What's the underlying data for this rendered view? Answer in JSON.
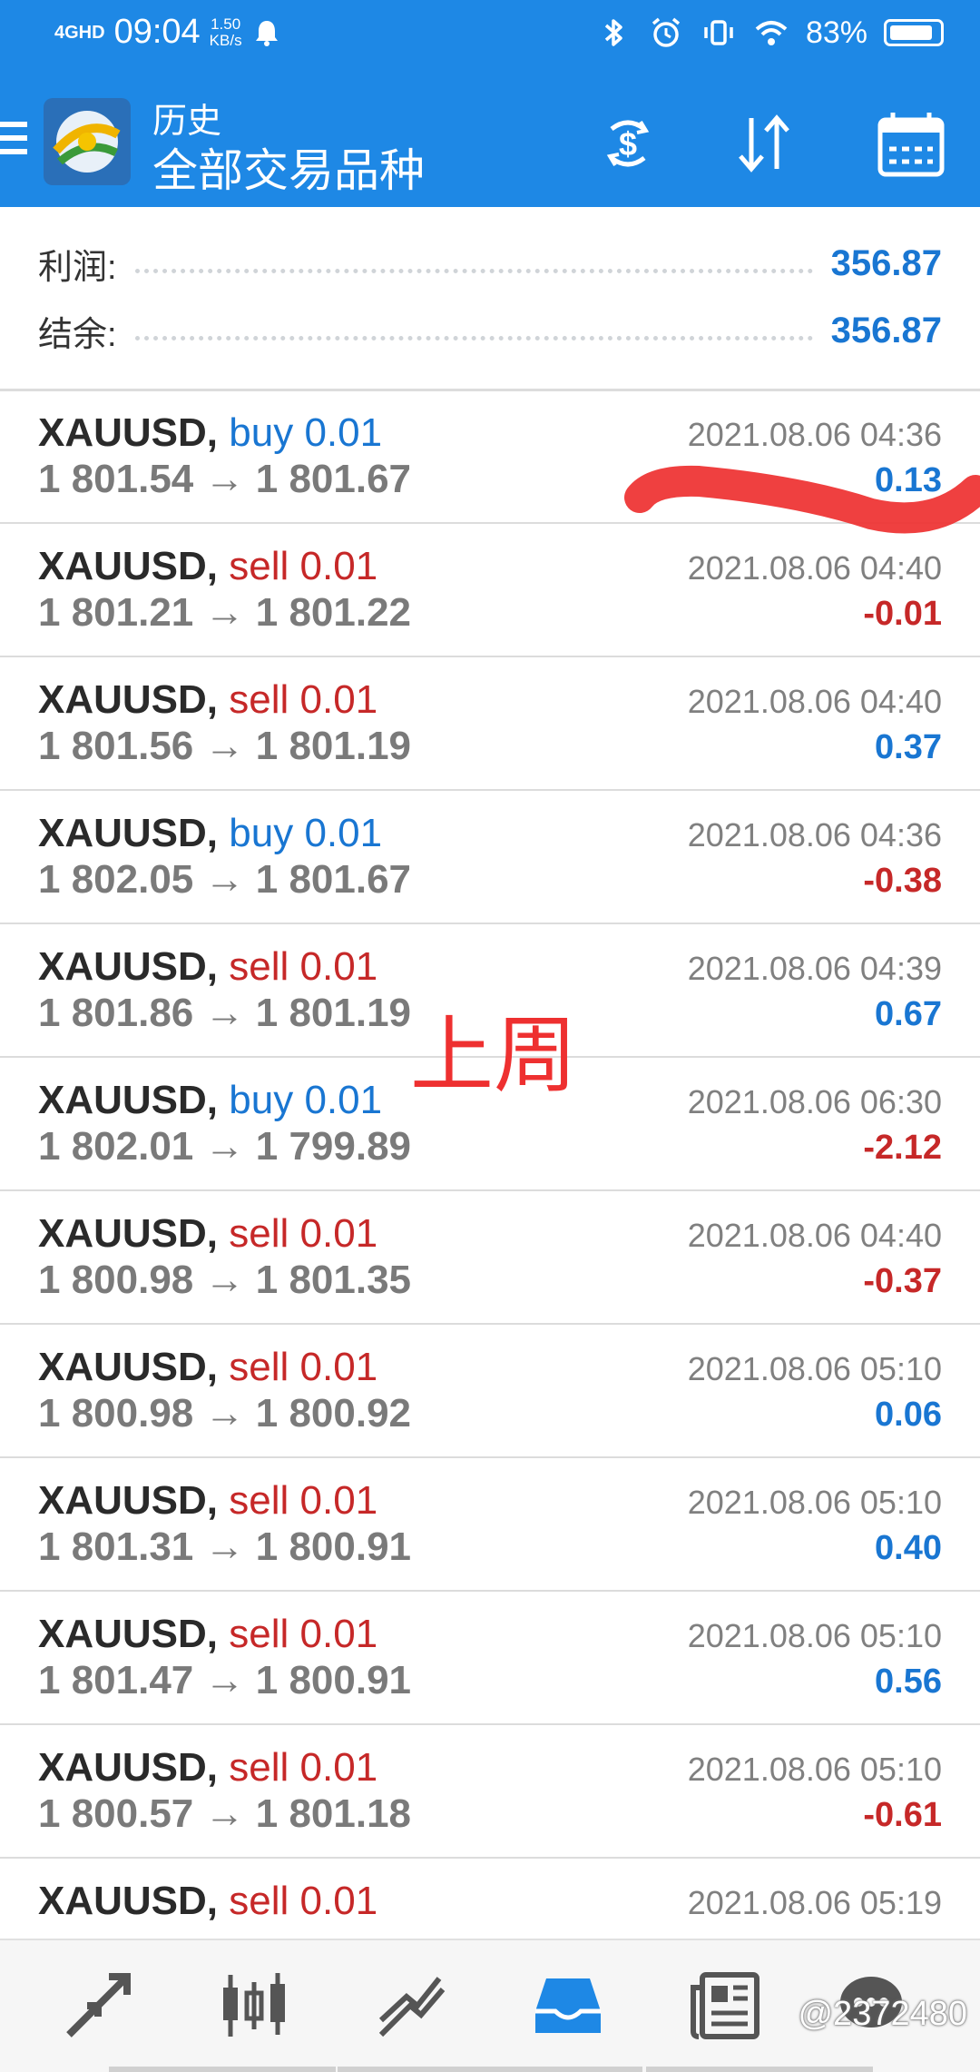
{
  "status_bar": {
    "network": "4GHD",
    "time": "09:04",
    "speed_value": "1.50",
    "speed_unit": "KB/s",
    "battery": "83%"
  },
  "app_bar": {
    "title": "历史",
    "subtitle": "全部交易品种",
    "icons": [
      "menu-icon",
      "app-logo-icon",
      "currency-exchange-icon",
      "sort-icon",
      "calendar-icon"
    ]
  },
  "summary": {
    "profit_label": "利润:",
    "profit_value": "356.87",
    "balance_label": "结余:",
    "balance_value": "356.87"
  },
  "trades": [
    {
      "symbol": "XAUUSD,",
      "side": "buy",
      "volume": "0.01",
      "open": "1 801.54",
      "close": "1 801.67",
      "date": "2021.08.06 04:36",
      "profit": "0.13"
    },
    {
      "symbol": "XAUUSD,",
      "side": "sell",
      "volume": "0.01",
      "open": "1 801.21",
      "close": "1 801.22",
      "date": "2021.08.06 04:40",
      "profit": "-0.01"
    },
    {
      "symbol": "XAUUSD,",
      "side": "sell",
      "volume": "0.01",
      "open": "1 801.56",
      "close": "1 801.19",
      "date": "2021.08.06 04:40",
      "profit": "0.37"
    },
    {
      "symbol": "XAUUSD,",
      "side": "buy",
      "volume": "0.01",
      "open": "1 802.05",
      "close": "1 801.67",
      "date": "2021.08.06 04:36",
      "profit": "-0.38"
    },
    {
      "symbol": "XAUUSD,",
      "side": "sell",
      "volume": "0.01",
      "open": "1 801.86",
      "close": "1 801.19",
      "date": "2021.08.06 04:39",
      "profit": "0.67"
    },
    {
      "symbol": "XAUUSD,",
      "side": "buy",
      "volume": "0.01",
      "open": "1 802.01",
      "close": "1 799.89",
      "date": "2021.08.06 06:30",
      "profit": "-2.12"
    },
    {
      "symbol": "XAUUSD,",
      "side": "sell",
      "volume": "0.01",
      "open": "1 800.98",
      "close": "1 801.35",
      "date": "2021.08.06 04:40",
      "profit": "-0.37"
    },
    {
      "symbol": "XAUUSD,",
      "side": "sell",
      "volume": "0.01",
      "open": "1 800.98",
      "close": "1 800.92",
      "date": "2021.08.06 05:10",
      "profit": "0.06"
    },
    {
      "symbol": "XAUUSD,",
      "side": "sell",
      "volume": "0.01",
      "open": "1 801.31",
      "close": "1 800.91",
      "date": "2021.08.06 05:10",
      "profit": "0.40"
    },
    {
      "symbol": "XAUUSD,",
      "side": "sell",
      "volume": "0.01",
      "open": "1 801.47",
      "close": "1 800.91",
      "date": "2021.08.06 05:10",
      "profit": "0.56"
    },
    {
      "symbol": "XAUUSD,",
      "side": "sell",
      "volume": "0.01",
      "open": "1 800.57",
      "close": "1 801.18",
      "date": "2021.08.06 05:10",
      "profit": "-0.61"
    },
    {
      "symbol": "XAUUSD,",
      "side": "sell",
      "volume": "0.01",
      "open": "",
      "close": "",
      "date": "2021.08.06 05:19",
      "profit": ""
    }
  ],
  "annotation": {
    "text": "上周",
    "color": "#ee3030"
  },
  "bottom_nav": {
    "items": [
      "trade-arrows-icon",
      "candlestick-chart-icon",
      "trend-lines-icon",
      "history-inbox-icon",
      "news-icon",
      "chat-bubble-icon"
    ],
    "active": "history-inbox-icon",
    "watermark": "@2372480"
  },
  "colors": {
    "accent": "#1e88e5",
    "positive": "#1976d2",
    "negative": "#c62828"
  }
}
